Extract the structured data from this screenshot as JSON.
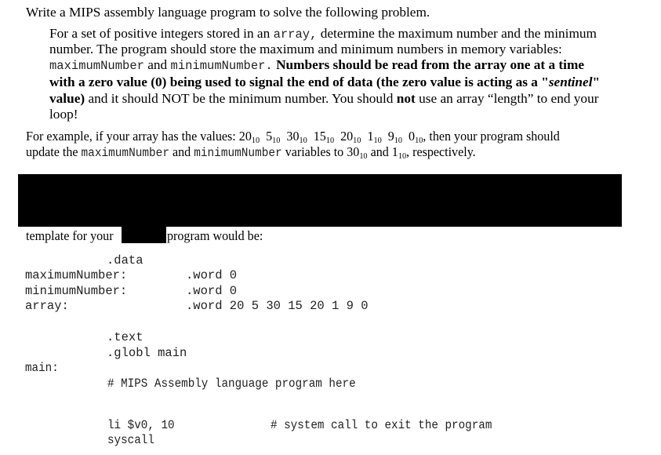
{
  "intro": "Write a MIPS assembly language program to solve the following problem.",
  "problem": {
    "l1_a": "For a set of positive integers stored in an ",
    "l1_code": "array,",
    "l1_b": " determine the maximum number and the minimum",
    "l2": "number.  The program should store the maximum and minimum numbers in memory variables:",
    "l3_code1": "maximumNumber",
    "l3_a": " and ",
    "l3_code2": "minimumNumber.",
    "l3_bold": "  Numbers should be read from the array one at a time",
    "l4_bold_a": "with a zero value (0) being used to signal the end of data (the zero value is acting as a \"",
    "l4_bold_italic": "sentinel",
    "l4_bold_b": "\"",
    "l5_bold": "value)",
    "l5_a": " and it should NOT be the minimum number.  You should ",
    "l5_bold2": "not",
    "l5_b": " use an array “length” to end your",
    "l6": "loop!"
  },
  "example": {
    "l1_a": "For example, if your array has the values: ",
    "values": [
      {
        "n": "20",
        "base": "10"
      },
      {
        "n": "5",
        "base": "10"
      },
      {
        "n": "30",
        "base": "10"
      },
      {
        "n": "15",
        "base": "10"
      },
      {
        "n": "20",
        "base": "10"
      },
      {
        "n": "1",
        "base": "10"
      },
      {
        "n": "9",
        "base": "10"
      },
      {
        "n": "0",
        "base": "10"
      }
    ],
    "l1_b": ", then your program should",
    "l2_a": "update the ",
    "l2_code1": "maximumNumber",
    "l2_b": " and ",
    "l2_code2": "minimumNumber",
    "l2_c": " variables to ",
    "max_n": "30",
    "max_base": "10",
    "l2_d": " and ",
    "min_n": "1",
    "min_base": "10",
    "l2_e": ", respectively."
  },
  "template_line": {
    "a": "template for your",
    "b": "program would be:"
  },
  "code": {
    "data_dir": ".data",
    "max_label": "maximumNumber:",
    "max_val": ".word 0",
    "min_label": "minimumNumber:",
    "min_val": ".word 0",
    "arr_label": "array:",
    "arr_val": ".word 20 5 30 15 20 1 9 0",
    "text_dir": ".text",
    "globl": ".globl main",
    "main_label": "main:",
    "comment": "# MIPS Assembly language program here",
    "li": "li $v0, 10",
    "li_comment": "# system call to exit the program",
    "syscall": "syscall"
  }
}
